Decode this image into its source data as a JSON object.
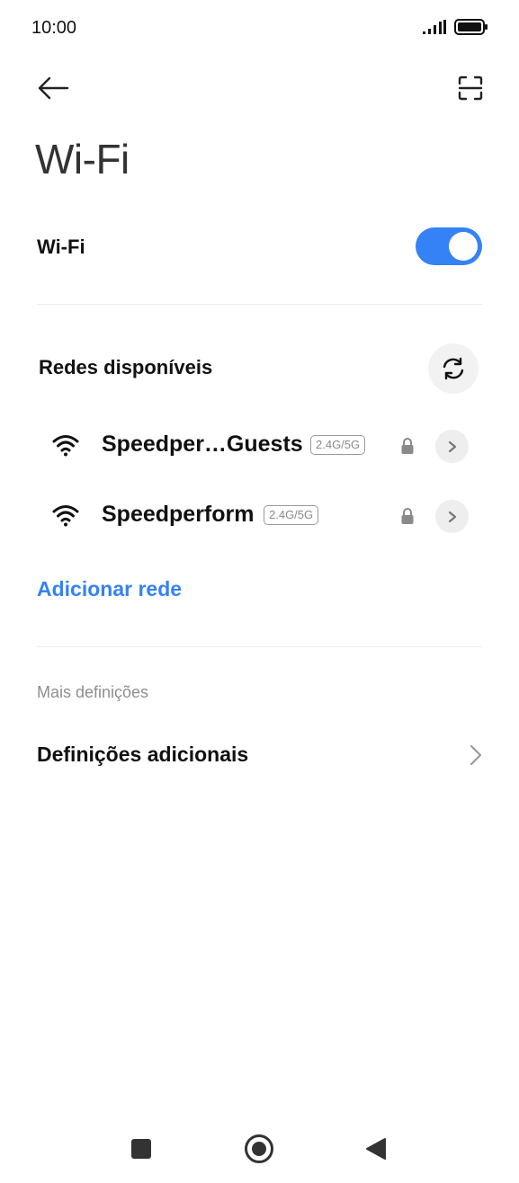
{
  "status": {
    "time": "10:00",
    "signal_icon": "signal-bars-icon",
    "battery_icon": "battery-full-icon"
  },
  "topbar": {
    "back_icon": "arrow-left-icon",
    "scan_icon": "qr-scan-icon"
  },
  "page": {
    "title": "Wi-Fi"
  },
  "wifi": {
    "label": "Wi-Fi",
    "enabled": true,
    "accent": "#3482f6"
  },
  "available": {
    "title": "Redes disponíveis",
    "refresh_icon": "refresh-icon",
    "networks": [
      {
        "name": "Speedper…Guests",
        "band": "2.4G/5G",
        "secured": true
      },
      {
        "name": "Speedperform",
        "band": "2.4G/5G",
        "secured": true
      }
    ]
  },
  "add_network": {
    "label": "Adicionar rede"
  },
  "more": {
    "section_title": "Mais definições",
    "item_label": "Definições adicionais"
  },
  "navbar": {
    "recents_icon": "square-icon",
    "home_icon": "circle-home-icon",
    "back_icon": "triangle-back-icon"
  }
}
